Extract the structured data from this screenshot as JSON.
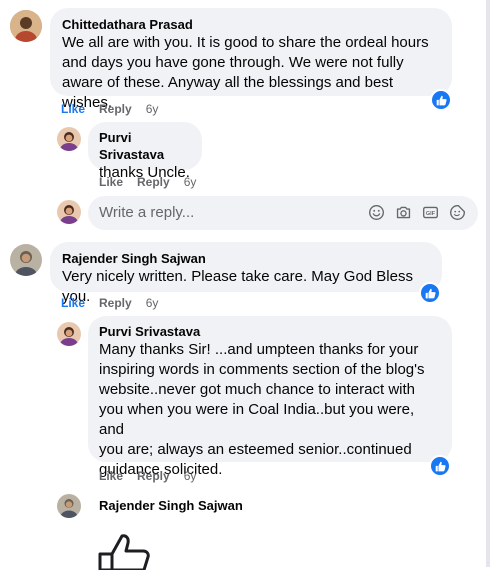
{
  "actions": {
    "like": "Like",
    "reply": "Reply",
    "time": "6y"
  },
  "reply_box": {
    "placeholder": "Write a reply..."
  },
  "comments": [
    {
      "author": "Chittedathara Prasad",
      "lines": [
        "We all are with you. It is good to share the ordeal hours",
        "and days you have gone through. We were not fully",
        "aware of these. Anyway all the blessings and best wishes."
      ],
      "liked": true
    },
    {
      "author": "Purvi Srivastava",
      "lines": [
        "thanks Uncle."
      ],
      "liked": false
    },
    {
      "author": "Rajender Singh Sajwan",
      "lines": [
        "Very nicely written. Please take care. May God Bless you."
      ],
      "liked": true
    },
    {
      "author": "Purvi Srivastava",
      "lines": [
        "Many thanks Sir! ...and umpteen thanks for your",
        "inspiring words in comments section of the blog's",
        "website..never got much chance to interact with",
        "you when you were in Coal India..but you were, and",
        "you are; always an esteemed senior..continued",
        "guidance solicited."
      ],
      "liked": false
    },
    {
      "author": "Rajender Singh Sajwan",
      "lines": [],
      "liked": false
    }
  ]
}
